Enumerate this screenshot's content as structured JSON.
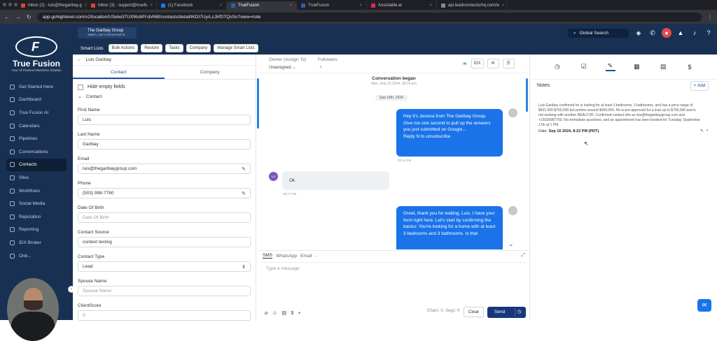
{
  "browser": {
    "tabs": [
      {
        "label": "Inbox (2) - luis@thegaribay.g",
        "color": "#d44638"
      },
      {
        "label": "Inbox (3) - support@truefu",
        "color": "#d44638"
      },
      {
        "label": "(1) Facebook",
        "color": "#1877f2"
      },
      {
        "label": "TrueFusion",
        "color": "#2d5fb5"
      },
      {
        "label": "TrueFusion",
        "color": "#2d5fb5"
      },
      {
        "label": "Assistable.ai",
        "color": "#e0245e"
      },
      {
        "label": "api.leadconnectorhq.com/w",
        "color": "#888888"
      }
    ],
    "url": "app.gohighlevel.com/v2/location/USelw37UXWuMYsfvN6f/contacts/detail/lKDI7UyrLcJlrfDTQsSo?view=note"
  },
  "sidebar": {
    "brand": "True Fusion",
    "tagline": "Your All Powered Business Solution",
    "items": [
      {
        "label": "Get Started Here"
      },
      {
        "label": "Dashboard"
      },
      {
        "label": "True Fusion AI"
      },
      {
        "label": "Calendars"
      },
      {
        "label": "Pipelines"
      },
      {
        "label": "Conversations"
      },
      {
        "label": "Contacts"
      },
      {
        "label": "Sites"
      },
      {
        "label": "Workflows"
      },
      {
        "label": "Social Media"
      },
      {
        "label": "Reputation"
      },
      {
        "label": "Reporting"
      },
      {
        "label": "IDX Broker"
      },
      {
        "label": "Onb..."
      }
    ],
    "collapse_icon": "‹"
  },
  "topbar": {
    "location_name": "The Garibay Group",
    "location_addr": "Salem, 222 Commercial St ...",
    "search": "Global Search",
    "avatar": "LG"
  },
  "actionbar": {
    "label": "Smart Lists",
    "buttons": [
      "Bulk Actions",
      "Restore",
      "Tasks",
      "Company",
      "Manage Smart Lists"
    ]
  },
  "contact": {
    "back_name": "Luis Garibay",
    "tabs": [
      "Contact",
      "Company"
    ],
    "hide_empty": "Hide empty fields",
    "section": "Contact",
    "fields": {
      "first_name_label": "First Name",
      "first_name": "Luis",
      "last_name_label": "Last Name",
      "last_name": "Garibay",
      "email_label": "Email",
      "email": "luis@thegaribaygroup.com",
      "phone_label": "Phone",
      "phone": "(503) 998-7760",
      "dob_label": "Date Of Birth",
      "dob_placeholder": "Date Of Birth",
      "source_label": "Contact Source",
      "source": "context testing",
      "type_label": "Contact Type",
      "type": "Lead",
      "spouse_label": "Spouse Name",
      "spouse_placeholder": "Spouse Name",
      "score_label": "ClientScore",
      "score": "0"
    }
  },
  "conversation": {
    "owner_label": "Owner (Assign To)",
    "owner_value": "Unassigned",
    "followers_label": "Followers",
    "idx": "IDX",
    "began": "Conversation began",
    "began_date": "Mon, Sep 16 2024, 08:14 pm",
    "day_sep": "Sep 16th, 2024",
    "messages": [
      {
        "text": "Hey it's Jessica from The Garibay Group. Give me one second to pull up the answers you just submitted on Google...\nReply N to unsubscribe",
        "time": "08:14 PM"
      },
      {
        "text": "Ok",
        "time": "08:17 PM",
        "avatar": "LG"
      },
      {
        "text": "Great, thank you for waiting, Luis. I have your form right here. Let's start by confirming the basics: You're looking for a home with at least 3 bedrooms and 3 bathrooms. Is that",
        "time": ""
      }
    ],
    "compose_tabs": [
      "SMS",
      "WhatsApp",
      "Email",
      "-"
    ],
    "placeholder": "Type a message",
    "chars": "Chars: 0, Segs: 0",
    "clear": "Clear",
    "send": "Send"
  },
  "notes": {
    "title": "Notes",
    "add": "+ Add",
    "body": "Luis Garibay confirmed he is looking for at least 3 bedrooms, 3 bathrooms, and has a price range of $501,000-$750,000 but prefers around $650,000. He is pre-approved for a loan up to $750,000 and is not working with another REALTOR. Confirmed contact info as luis@thegaribaygroup.com and +15039987760. No immediate questions, and an appointment has been booked for Tuesday, September 17th at 1 PM.",
    "date_label": "Date:",
    "date": "Sep 16 2024, 8:22 PM (PDT)"
  }
}
